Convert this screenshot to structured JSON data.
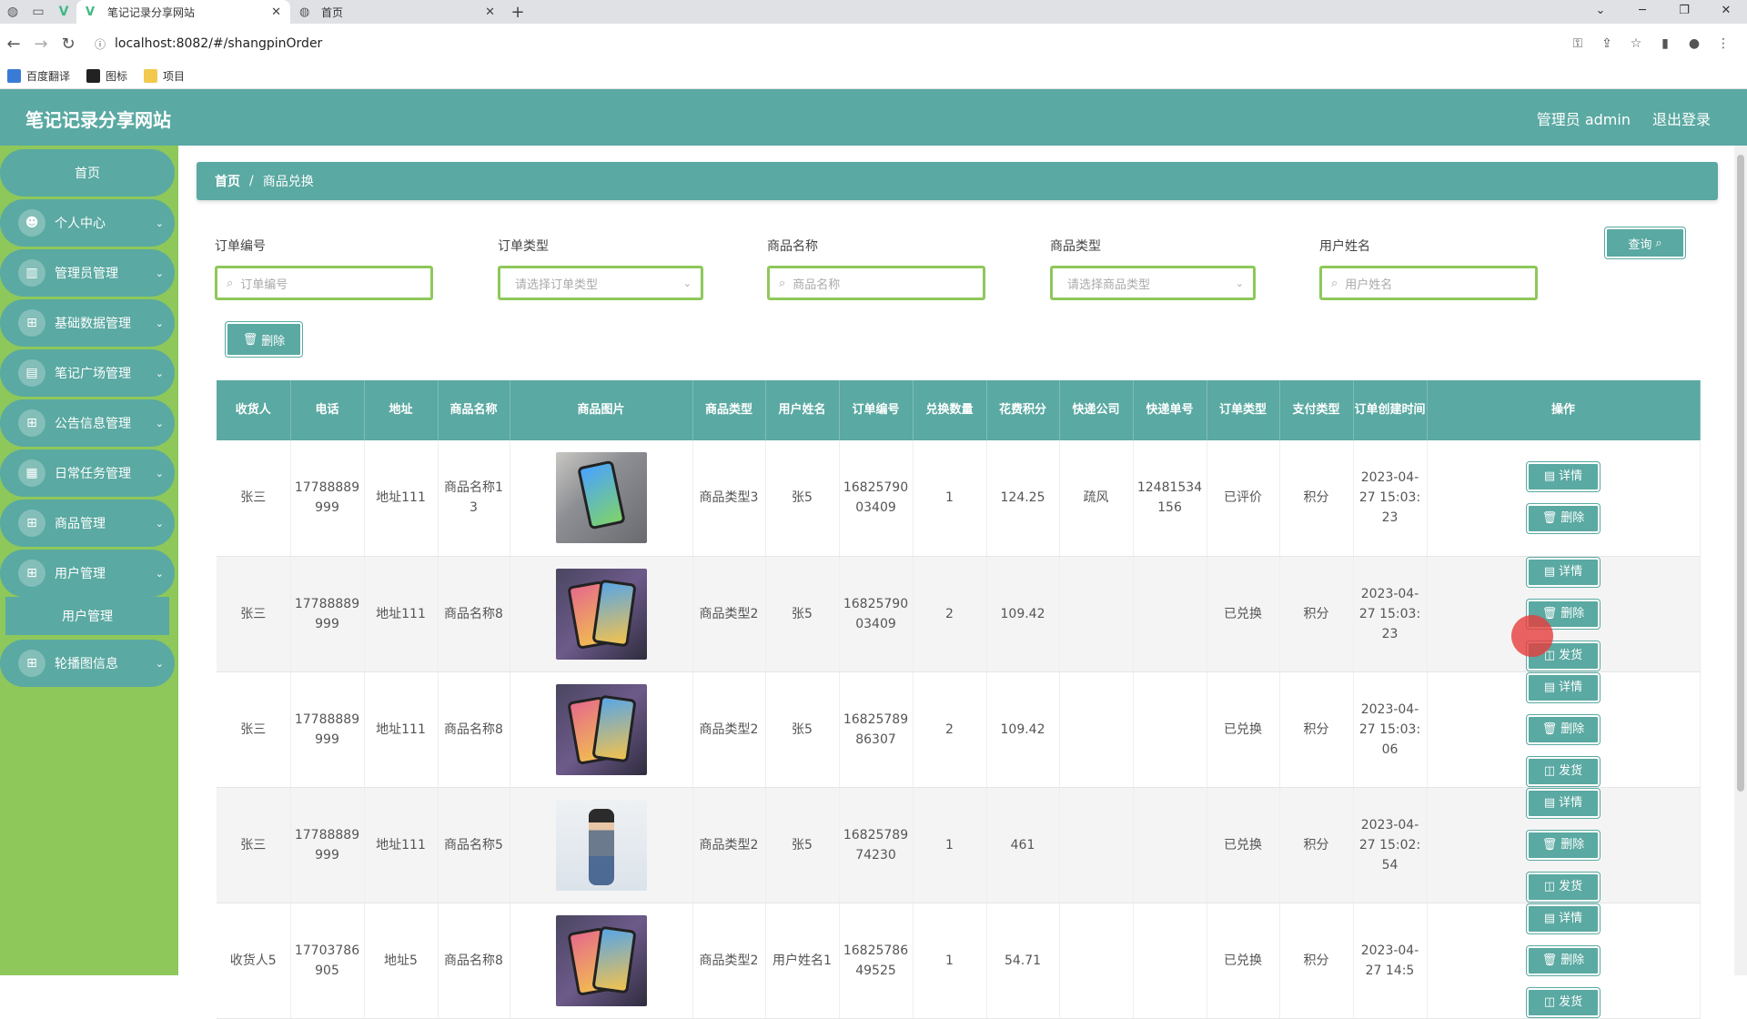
{
  "browser": {
    "tabs": [
      {
        "title": "笔记记录分享网站",
        "active": true
      },
      {
        "title": "首页",
        "active": false
      }
    ],
    "url": "localhost:8082/#/shangpinOrder",
    "bookmarks": [
      "百度翻译",
      "图标",
      "项目"
    ]
  },
  "header": {
    "title": "笔记记录分享网站",
    "user": "管理员 admin",
    "logout": "退出登录"
  },
  "sidebar": {
    "home": "首页",
    "items": [
      {
        "label": "个人中心",
        "icon": "user-icon"
      },
      {
        "label": "管理员管理",
        "icon": "chart-icon"
      },
      {
        "label": "基础数据管理",
        "icon": "grid-icon"
      },
      {
        "label": "笔记广场管理",
        "icon": "briefcase-icon"
      },
      {
        "label": "公告信息管理",
        "icon": "grid-icon"
      },
      {
        "label": "日常任务管理",
        "icon": "document-icon"
      },
      {
        "label": "商品管理",
        "icon": "grid-icon"
      },
      {
        "label": "用户管理",
        "icon": "grid-icon"
      },
      {
        "label": "轮播图信息",
        "icon": "grid-icon"
      }
    ],
    "sub_active": "用户管理"
  },
  "breadcrumb": {
    "home": "首页",
    "sep": "/",
    "current": "商品兑换"
  },
  "filters": {
    "order_no": {
      "label": "订单编号",
      "placeholder": "订单编号"
    },
    "order_type": {
      "label": "订单类型",
      "placeholder": "请选择订单类型"
    },
    "goods_name": {
      "label": "商品名称",
      "placeholder": "商品名称"
    },
    "goods_type": {
      "label": "商品类型",
      "placeholder": "请选择商品类型"
    },
    "user_name": {
      "label": "用户姓名",
      "placeholder": "用户姓名"
    },
    "query": "查询",
    "delete": "删除"
  },
  "table": {
    "headers": [
      "收货人",
      "电话",
      "地址",
      "商品名称",
      "商品图片",
      "商品类型",
      "用户姓名",
      "订单编号",
      "兑换数量",
      "花费积分",
      "快递公司",
      "快递单号",
      "订单类型",
      "支付类型",
      "订单创建时间",
      "操作"
    ],
    "actions": {
      "detail": "详情",
      "delete": "删除",
      "ship": "发货"
    },
    "rows": [
      {
        "receiver": "张三",
        "phone": "17788889999",
        "address": "地址111",
        "goods": "商品名称13",
        "img": "a",
        "gtype": "商品类型3",
        "user": "张5",
        "order": "1682579003409",
        "qty": "1",
        "points": "124.25",
        "courier": "疏风",
        "tracking": "12481534156",
        "otype": "已评价",
        "pay": "积分",
        "time": "2023-04-27 15:03:23",
        "ship": false
      },
      {
        "receiver": "张三",
        "phone": "17788889999",
        "address": "地址111",
        "goods": "商品名称8",
        "img": "b",
        "gtype": "商品类型2",
        "user": "张5",
        "order": "1682579003409",
        "qty": "2",
        "points": "109.42",
        "courier": "",
        "tracking": "",
        "otype": "已兑换",
        "pay": "积分",
        "time": "2023-04-27 15:03:23",
        "ship": true
      },
      {
        "receiver": "张三",
        "phone": "17788889999",
        "address": "地址111",
        "goods": "商品名称8",
        "img": "b",
        "gtype": "商品类型2",
        "user": "张5",
        "order": "1682578986307",
        "qty": "2",
        "points": "109.42",
        "courier": "",
        "tracking": "",
        "otype": "已兑换",
        "pay": "积分",
        "time": "2023-04-27 15:03:06",
        "ship": true
      },
      {
        "receiver": "张三",
        "phone": "17788889999",
        "address": "地址111",
        "goods": "商品名称5",
        "img": "c",
        "gtype": "商品类型2",
        "user": "张5",
        "order": "1682578974230",
        "qty": "1",
        "points": "461",
        "courier": "",
        "tracking": "",
        "otype": "已兑换",
        "pay": "积分",
        "time": "2023-04-27 15:02:54",
        "ship": true
      },
      {
        "receiver": "收货人5",
        "phone": "17703786905",
        "address": "地址5",
        "goods": "商品名称8",
        "img": "b",
        "gtype": "商品类型2",
        "user": "用户姓名1",
        "order": "1682578649525",
        "qty": "1",
        "points": "54.71",
        "courier": "",
        "tracking": "",
        "otype": "已兑换",
        "pay": "积分",
        "time": "2023-04-27 14:5",
        "ship": true
      }
    ]
  },
  "colors": {
    "primary": "#5aa9a2",
    "sidebar_bg": "#8ec85a",
    "input_border": "#8ec85a"
  }
}
